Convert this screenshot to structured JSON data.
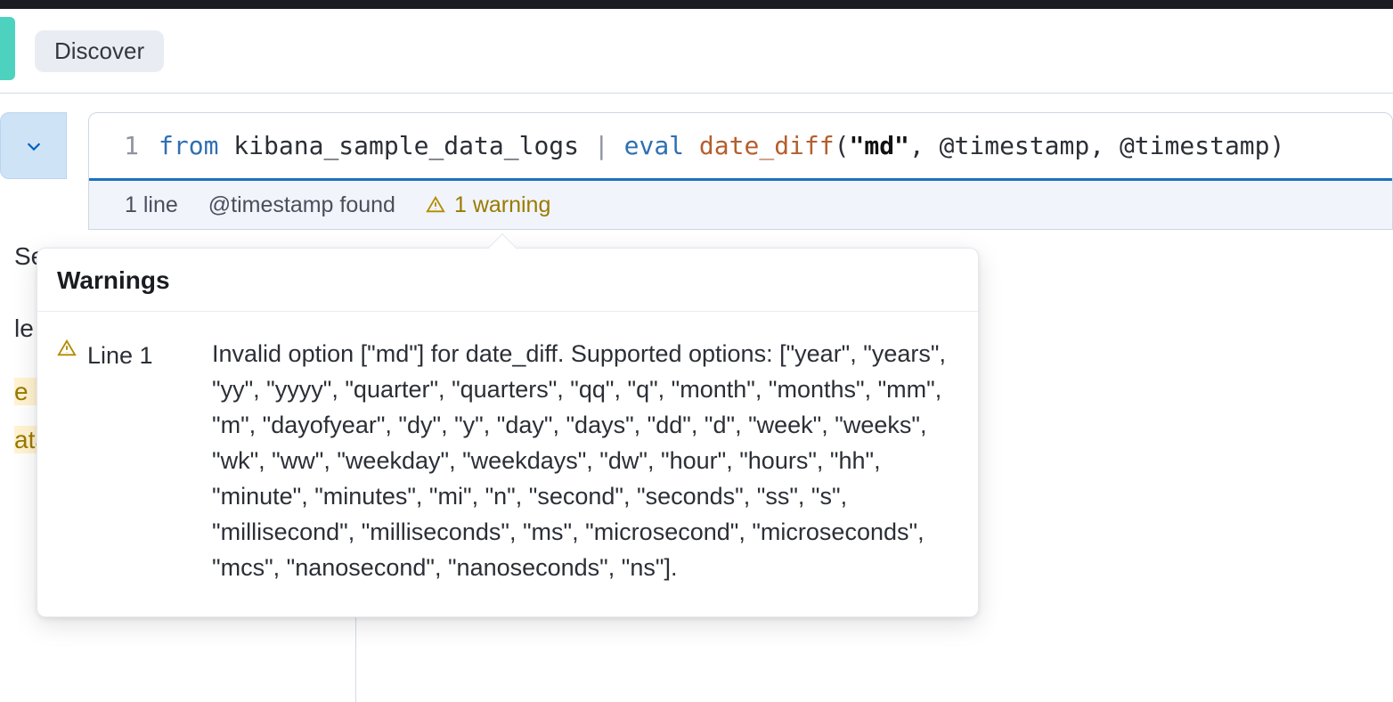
{
  "header": {
    "app_label": "Discover"
  },
  "dropdown": {
    "aria": "Expand query options"
  },
  "editor": {
    "lineno": "1",
    "tokens": {
      "kw_from": "from",
      "index": "kibana_sample_data_logs",
      "pipe": "|",
      "kw_eval": "eval",
      "fn": "date_diff",
      "lparen": "(",
      "str": "\"md\"",
      "comma1": ", ",
      "arg1": "@timestamp",
      "comma2": ", ",
      "arg2": "@timestamp",
      "rparen": ")"
    }
  },
  "status": {
    "lines": "1 line",
    "field": "@timestamp found",
    "warning": "1 warning"
  },
  "sidebar_truncated": {
    "l1": "Se",
    "l2": "le fi",
    "l3": "e no",
    "l4": "ata"
  },
  "popover": {
    "title": "Warnings",
    "line_label": "Line 1",
    "message": "Invalid option [\"md\"] for date_diff. Supported options: [\"year\", \"years\", \"yy\", \"yyyy\", \"quarter\", \"quarters\", \"qq\", \"q\", \"month\", \"months\", \"mm\", \"m\", \"dayofyear\", \"dy\", \"y\", \"day\", \"days\", \"dd\", \"d\", \"week\", \"weeks\", \"wk\", \"ww\", \"weekday\", \"weekdays\", \"dw\", \"hour\", \"hours\", \"hh\", \"minute\", \"minutes\", \"mi\", \"n\", \"second\", \"seconds\", \"ss\", \"s\", \"millisecond\", \"milliseconds\", \"ms\", \"microsecond\", \"microseconds\", \"mcs\", \"nanosecond\", \"nanoseconds\", \"ns\"]."
  }
}
